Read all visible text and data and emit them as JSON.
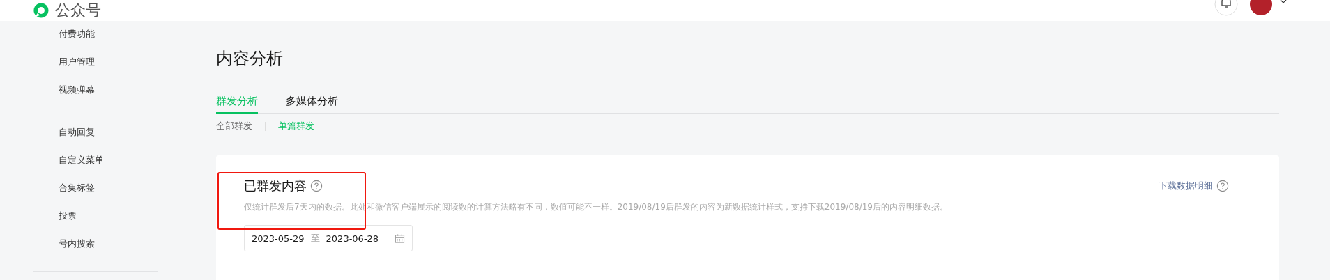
{
  "header": {
    "logo_text": "公众号"
  },
  "sidebar": {
    "groups": [
      {
        "items": [
          {
            "label": "付费功能"
          },
          {
            "label": "用户管理"
          },
          {
            "label": "视频弹幕"
          }
        ]
      },
      {
        "items": [
          {
            "label": "自动回复"
          },
          {
            "label": "自定义菜单"
          },
          {
            "label": "合集标签"
          },
          {
            "label": "投票"
          },
          {
            "label": "号内搜索"
          }
        ]
      }
    ]
  },
  "page": {
    "title": "内容分析",
    "tabs": [
      {
        "label": "群发分析",
        "selected": true
      },
      {
        "label": "多媒体分析",
        "selected": false
      }
    ],
    "subtabs": [
      {
        "label": "全部群发",
        "selected": false
      },
      {
        "label": "单篇群发",
        "selected": true
      }
    ]
  },
  "card": {
    "title": "已群发内容",
    "description": "仅统计群发后7天内的数据。此处和微信客户端展示的阅读数的计算方法略有不同，数值可能不一样。2019/08/19后群发的内容为新数据统计样式，支持下载2019/08/19后的内容明细数据。",
    "download_link": "下载数据明细",
    "date_start": "2023-05-29",
    "date_separator": "至",
    "date_end": "2023-06-28",
    "highlighted": true
  }
}
